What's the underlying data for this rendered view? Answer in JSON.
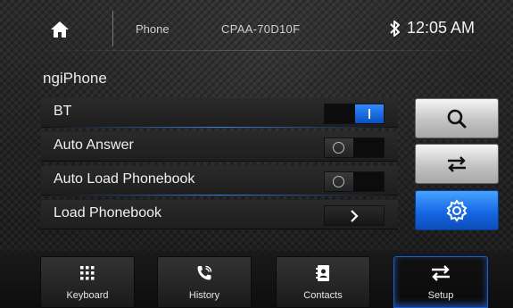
{
  "topbar": {
    "home_icon": "home-icon",
    "tab_label": "Phone",
    "device_id": "CPAA-70D10F",
    "bluetooth_icon": "bluetooth-icon",
    "clock": "12:05 AM"
  },
  "device_name": "ngiPhone",
  "settings": [
    {
      "label": "BT",
      "control": "toggle",
      "state": "on"
    },
    {
      "label": "Auto Answer",
      "control": "toggle",
      "state": "off"
    },
    {
      "label": "Auto Load Phonebook",
      "control": "toggle",
      "state": "off"
    },
    {
      "label": "Load Phonebook",
      "control": "chevron"
    }
  ],
  "side_buttons": [
    {
      "icon": "search-icon",
      "style": "grey"
    },
    {
      "icon": "swap-arrows-icon",
      "style": "grey"
    },
    {
      "icon": "gear-icon",
      "style": "blue",
      "selected": true
    }
  ],
  "bottom_tabs": [
    {
      "label": "Keyboard",
      "icon": "keypad-icon"
    },
    {
      "label": "History",
      "icon": "phone-call-icon"
    },
    {
      "label": "Contacts",
      "icon": "contacts-book-icon"
    },
    {
      "label": "Setup",
      "icon": "swap-arrows-icon",
      "active": true
    }
  ],
  "colors": {
    "accent": "#1e6cff",
    "toggle_on": "#2f8bff"
  }
}
